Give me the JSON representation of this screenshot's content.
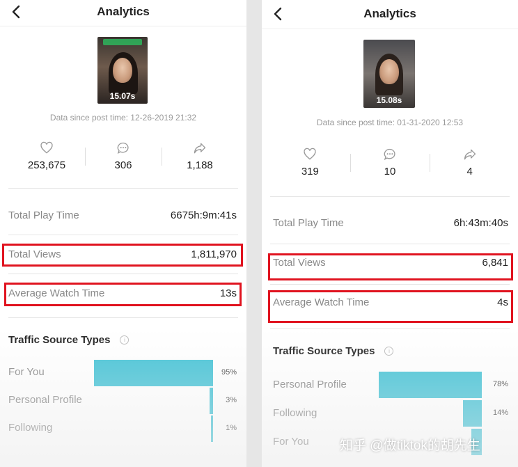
{
  "panels": [
    {
      "title": "Analytics",
      "video": {
        "duration": "15.07s"
      },
      "data_since": "Data since post time: 12-26-2019 21:32",
      "stats": [
        {
          "icon": "heart-icon",
          "value": "253,675"
        },
        {
          "icon": "comment-icon",
          "value": "306"
        },
        {
          "icon": "share-icon",
          "value": "1,188"
        }
      ],
      "metrics": [
        {
          "label": "Total Play Time",
          "value": "6675h:9m:41s",
          "highlighted": false
        },
        {
          "label": "Total Views",
          "value": "1,811,970",
          "highlighted": true
        },
        {
          "label": "Average Watch Time",
          "value": "13s",
          "highlighted": true
        }
      ],
      "traffic_title": "Traffic Source Types",
      "traffic": [
        {
          "label": "For You",
          "percent": 95,
          "display": "95%"
        },
        {
          "label": "Personal Profile",
          "percent": 3,
          "display": "3%"
        },
        {
          "label": "Following",
          "percent": 1,
          "display": "1%"
        }
      ]
    },
    {
      "title": "Analytics",
      "video": {
        "duration": "15.08s"
      },
      "data_since": "Data since post time: 01-31-2020 12:53",
      "stats": [
        {
          "icon": "heart-icon",
          "value": "319"
        },
        {
          "icon": "comment-icon",
          "value": "10"
        },
        {
          "icon": "share-icon",
          "value": "4"
        }
      ],
      "metrics": [
        {
          "label": "Total Play Time",
          "value": "6h:43m:40s",
          "highlighted": false
        },
        {
          "label": "Total Views",
          "value": "6,841",
          "highlighted": true
        },
        {
          "label": "Average Watch Time",
          "value": "4s",
          "highlighted": true
        }
      ],
      "traffic_title": "Traffic Source Types",
      "traffic": [
        {
          "label": "Personal Profile",
          "percent": 78,
          "display": "78%"
        },
        {
          "label": "Following",
          "percent": 14,
          "display": "14%"
        },
        {
          "label": "For You",
          "percent": 8,
          "display": ""
        }
      ]
    }
  ],
  "watermark": "知乎 @做tiktok的胡先生",
  "colors": {
    "bar": "#45c3d6",
    "highlight": "#e0131f"
  }
}
